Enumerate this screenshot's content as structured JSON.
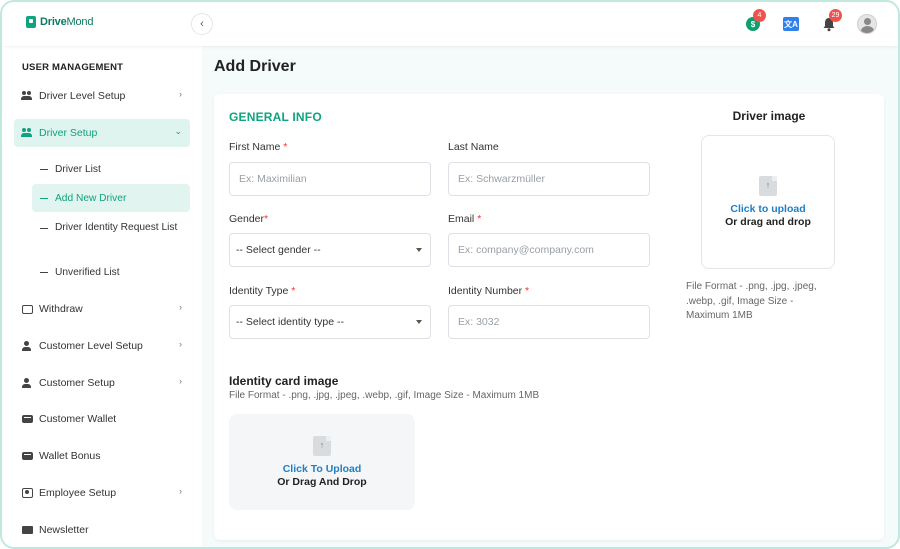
{
  "brand": {
    "name_bold": "Drive",
    "name_thin": "Mond",
    "accent": "#10a37f"
  },
  "topbar": {
    "coin_badge": "4",
    "coin_label": "$",
    "lang_label": "文A",
    "notification_badge": "29"
  },
  "sidebar": {
    "section_title": "USER MANAGEMENT",
    "items": [
      {
        "label": "Driver Level Setup"
      },
      {
        "label": "Driver Setup"
      },
      {
        "label": "Withdraw"
      },
      {
        "label": "Customer Level Setup"
      },
      {
        "label": "Customer Setup"
      },
      {
        "label": "Customer Wallet"
      },
      {
        "label": "Wallet Bonus"
      },
      {
        "label": "Employee Setup"
      },
      {
        "label": "Newsletter"
      }
    ],
    "sub_items": [
      {
        "label": "Driver List"
      },
      {
        "label": "Add New Driver"
      },
      {
        "label": "Driver Identity Request List"
      },
      {
        "label": "Unverified List"
      }
    ]
  },
  "main": {
    "page_title": "Add Driver",
    "general_info_title": "GENERAL INFO",
    "fields": {
      "first_name": {
        "label": "First Name",
        "required": "*",
        "placeholder": "Ex: Maximilian"
      },
      "last_name": {
        "label": "Last Name",
        "placeholder": "Ex: Schwarzmüller"
      },
      "gender": {
        "label": "Gender",
        "required": "*",
        "value": "-- Select gender --"
      },
      "email": {
        "label": "Email",
        "required": "*",
        "placeholder": "Ex: company@company.com"
      },
      "identity_type": {
        "label": "Identity Type",
        "required": "*",
        "value": "-- Select identity type --"
      },
      "identity_number": {
        "label": "Identity Number",
        "required": "*",
        "placeholder": "Ex: 3032"
      }
    },
    "driver_image": {
      "title": "Driver image",
      "link": "Click to upload",
      "sub": "Or drag and drop",
      "format_note": "File Format - .png, .jpg, .jpeg, .webp, .gif, Image Size - Maximum 1MB"
    },
    "identity_card": {
      "title": "Identity card image",
      "format_note": "File Format - .png, .jpg, .jpeg, .webp, .gif, Image Size - Maximum 1MB",
      "link": "Click To Upload",
      "sub": "Or Drag And Drop"
    }
  }
}
